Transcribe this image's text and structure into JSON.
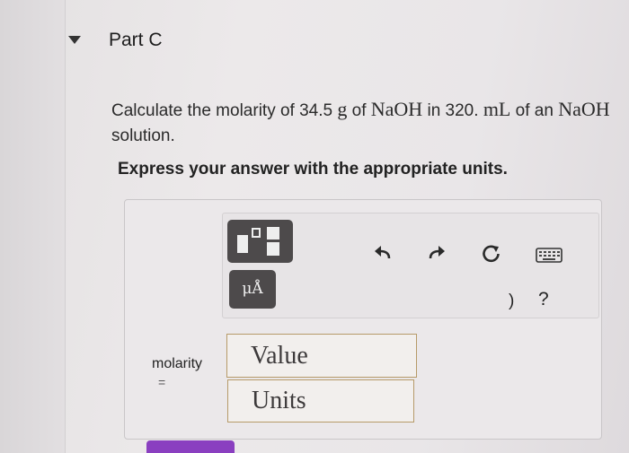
{
  "section": {
    "title": "Part C",
    "toggle_icon": "triangle-down-icon"
  },
  "question": {
    "part1": "Calculate the molarity of 34.5 ",
    "g_unit": "g",
    "part2": " of ",
    "formula1": "NaOH",
    "part3": " in 320. ",
    "ml_unit": "mL",
    "part4": " of an ",
    "formula2": "NaOH",
    "part5": " solution."
  },
  "instruction": "Express your answer with the appropriate units.",
  "toolbar": {
    "templates_icon": "templates-icon",
    "units_button_label": "μÅ",
    "undo_icon": "undo-icon",
    "redo_icon": "redo-icon",
    "reset_icon": "reset-icon",
    "keyboard_icon": "keyboard-icon",
    "paren_text": ")",
    "help_text": "?"
  },
  "answer": {
    "label": "molarity",
    "equals": "=",
    "value_placeholder": "Value",
    "units_placeholder": "Units"
  },
  "colors": {
    "field_border": "#b69a69",
    "toolbar_button": "#4d4a4b",
    "submit_button": "#8a3fc0"
  }
}
